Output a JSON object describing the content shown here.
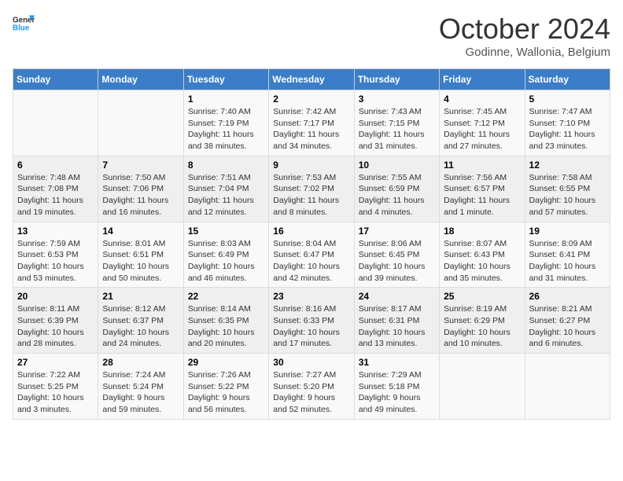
{
  "logo": {
    "line1": "General",
    "line2": "Blue"
  },
  "title": "October 2024",
  "location": "Godinne, Wallonia, Belgium",
  "days_of_week": [
    "Sunday",
    "Monday",
    "Tuesday",
    "Wednesday",
    "Thursday",
    "Friday",
    "Saturday"
  ],
  "weeks": [
    [
      {
        "day": "",
        "sunrise": "",
        "sunset": "",
        "daylight": ""
      },
      {
        "day": "",
        "sunrise": "",
        "sunset": "",
        "daylight": ""
      },
      {
        "day": "1",
        "sunrise": "Sunrise: 7:40 AM",
        "sunset": "Sunset: 7:19 PM",
        "daylight": "Daylight: 11 hours and 38 minutes."
      },
      {
        "day": "2",
        "sunrise": "Sunrise: 7:42 AM",
        "sunset": "Sunset: 7:17 PM",
        "daylight": "Daylight: 11 hours and 34 minutes."
      },
      {
        "day": "3",
        "sunrise": "Sunrise: 7:43 AM",
        "sunset": "Sunset: 7:15 PM",
        "daylight": "Daylight: 11 hours and 31 minutes."
      },
      {
        "day": "4",
        "sunrise": "Sunrise: 7:45 AM",
        "sunset": "Sunset: 7:12 PM",
        "daylight": "Daylight: 11 hours and 27 minutes."
      },
      {
        "day": "5",
        "sunrise": "Sunrise: 7:47 AM",
        "sunset": "Sunset: 7:10 PM",
        "daylight": "Daylight: 11 hours and 23 minutes."
      }
    ],
    [
      {
        "day": "6",
        "sunrise": "Sunrise: 7:48 AM",
        "sunset": "Sunset: 7:08 PM",
        "daylight": "Daylight: 11 hours and 19 minutes."
      },
      {
        "day": "7",
        "sunrise": "Sunrise: 7:50 AM",
        "sunset": "Sunset: 7:06 PM",
        "daylight": "Daylight: 11 hours and 16 minutes."
      },
      {
        "day": "8",
        "sunrise": "Sunrise: 7:51 AM",
        "sunset": "Sunset: 7:04 PM",
        "daylight": "Daylight: 11 hours and 12 minutes."
      },
      {
        "day": "9",
        "sunrise": "Sunrise: 7:53 AM",
        "sunset": "Sunset: 7:02 PM",
        "daylight": "Daylight: 11 hours and 8 minutes."
      },
      {
        "day": "10",
        "sunrise": "Sunrise: 7:55 AM",
        "sunset": "Sunset: 6:59 PM",
        "daylight": "Daylight: 11 hours and 4 minutes."
      },
      {
        "day": "11",
        "sunrise": "Sunrise: 7:56 AM",
        "sunset": "Sunset: 6:57 PM",
        "daylight": "Daylight: 11 hours and 1 minute."
      },
      {
        "day": "12",
        "sunrise": "Sunrise: 7:58 AM",
        "sunset": "Sunset: 6:55 PM",
        "daylight": "Daylight: 10 hours and 57 minutes."
      }
    ],
    [
      {
        "day": "13",
        "sunrise": "Sunrise: 7:59 AM",
        "sunset": "Sunset: 6:53 PM",
        "daylight": "Daylight: 10 hours and 53 minutes."
      },
      {
        "day": "14",
        "sunrise": "Sunrise: 8:01 AM",
        "sunset": "Sunset: 6:51 PM",
        "daylight": "Daylight: 10 hours and 50 minutes."
      },
      {
        "day": "15",
        "sunrise": "Sunrise: 8:03 AM",
        "sunset": "Sunset: 6:49 PM",
        "daylight": "Daylight: 10 hours and 46 minutes."
      },
      {
        "day": "16",
        "sunrise": "Sunrise: 8:04 AM",
        "sunset": "Sunset: 6:47 PM",
        "daylight": "Daylight: 10 hours and 42 minutes."
      },
      {
        "day": "17",
        "sunrise": "Sunrise: 8:06 AM",
        "sunset": "Sunset: 6:45 PM",
        "daylight": "Daylight: 10 hours and 39 minutes."
      },
      {
        "day": "18",
        "sunrise": "Sunrise: 8:07 AM",
        "sunset": "Sunset: 6:43 PM",
        "daylight": "Daylight: 10 hours and 35 minutes."
      },
      {
        "day": "19",
        "sunrise": "Sunrise: 8:09 AM",
        "sunset": "Sunset: 6:41 PM",
        "daylight": "Daylight: 10 hours and 31 minutes."
      }
    ],
    [
      {
        "day": "20",
        "sunrise": "Sunrise: 8:11 AM",
        "sunset": "Sunset: 6:39 PM",
        "daylight": "Daylight: 10 hours and 28 minutes."
      },
      {
        "day": "21",
        "sunrise": "Sunrise: 8:12 AM",
        "sunset": "Sunset: 6:37 PM",
        "daylight": "Daylight: 10 hours and 24 minutes."
      },
      {
        "day": "22",
        "sunrise": "Sunrise: 8:14 AM",
        "sunset": "Sunset: 6:35 PM",
        "daylight": "Daylight: 10 hours and 20 minutes."
      },
      {
        "day": "23",
        "sunrise": "Sunrise: 8:16 AM",
        "sunset": "Sunset: 6:33 PM",
        "daylight": "Daylight: 10 hours and 17 minutes."
      },
      {
        "day": "24",
        "sunrise": "Sunrise: 8:17 AM",
        "sunset": "Sunset: 6:31 PM",
        "daylight": "Daylight: 10 hours and 13 minutes."
      },
      {
        "day": "25",
        "sunrise": "Sunrise: 8:19 AM",
        "sunset": "Sunset: 6:29 PM",
        "daylight": "Daylight: 10 hours and 10 minutes."
      },
      {
        "day": "26",
        "sunrise": "Sunrise: 8:21 AM",
        "sunset": "Sunset: 6:27 PM",
        "daylight": "Daylight: 10 hours and 6 minutes."
      }
    ],
    [
      {
        "day": "27",
        "sunrise": "Sunrise: 7:22 AM",
        "sunset": "Sunset: 5:25 PM",
        "daylight": "Daylight: 10 hours and 3 minutes."
      },
      {
        "day": "28",
        "sunrise": "Sunrise: 7:24 AM",
        "sunset": "Sunset: 5:24 PM",
        "daylight": "Daylight: 9 hours and 59 minutes."
      },
      {
        "day": "29",
        "sunrise": "Sunrise: 7:26 AM",
        "sunset": "Sunset: 5:22 PM",
        "daylight": "Daylight: 9 hours and 56 minutes."
      },
      {
        "day": "30",
        "sunrise": "Sunrise: 7:27 AM",
        "sunset": "Sunset: 5:20 PM",
        "daylight": "Daylight: 9 hours and 52 minutes."
      },
      {
        "day": "31",
        "sunrise": "Sunrise: 7:29 AM",
        "sunset": "Sunset: 5:18 PM",
        "daylight": "Daylight: 9 hours and 49 minutes."
      },
      {
        "day": "",
        "sunrise": "",
        "sunset": "",
        "daylight": ""
      },
      {
        "day": "",
        "sunrise": "",
        "sunset": "",
        "daylight": ""
      }
    ]
  ]
}
